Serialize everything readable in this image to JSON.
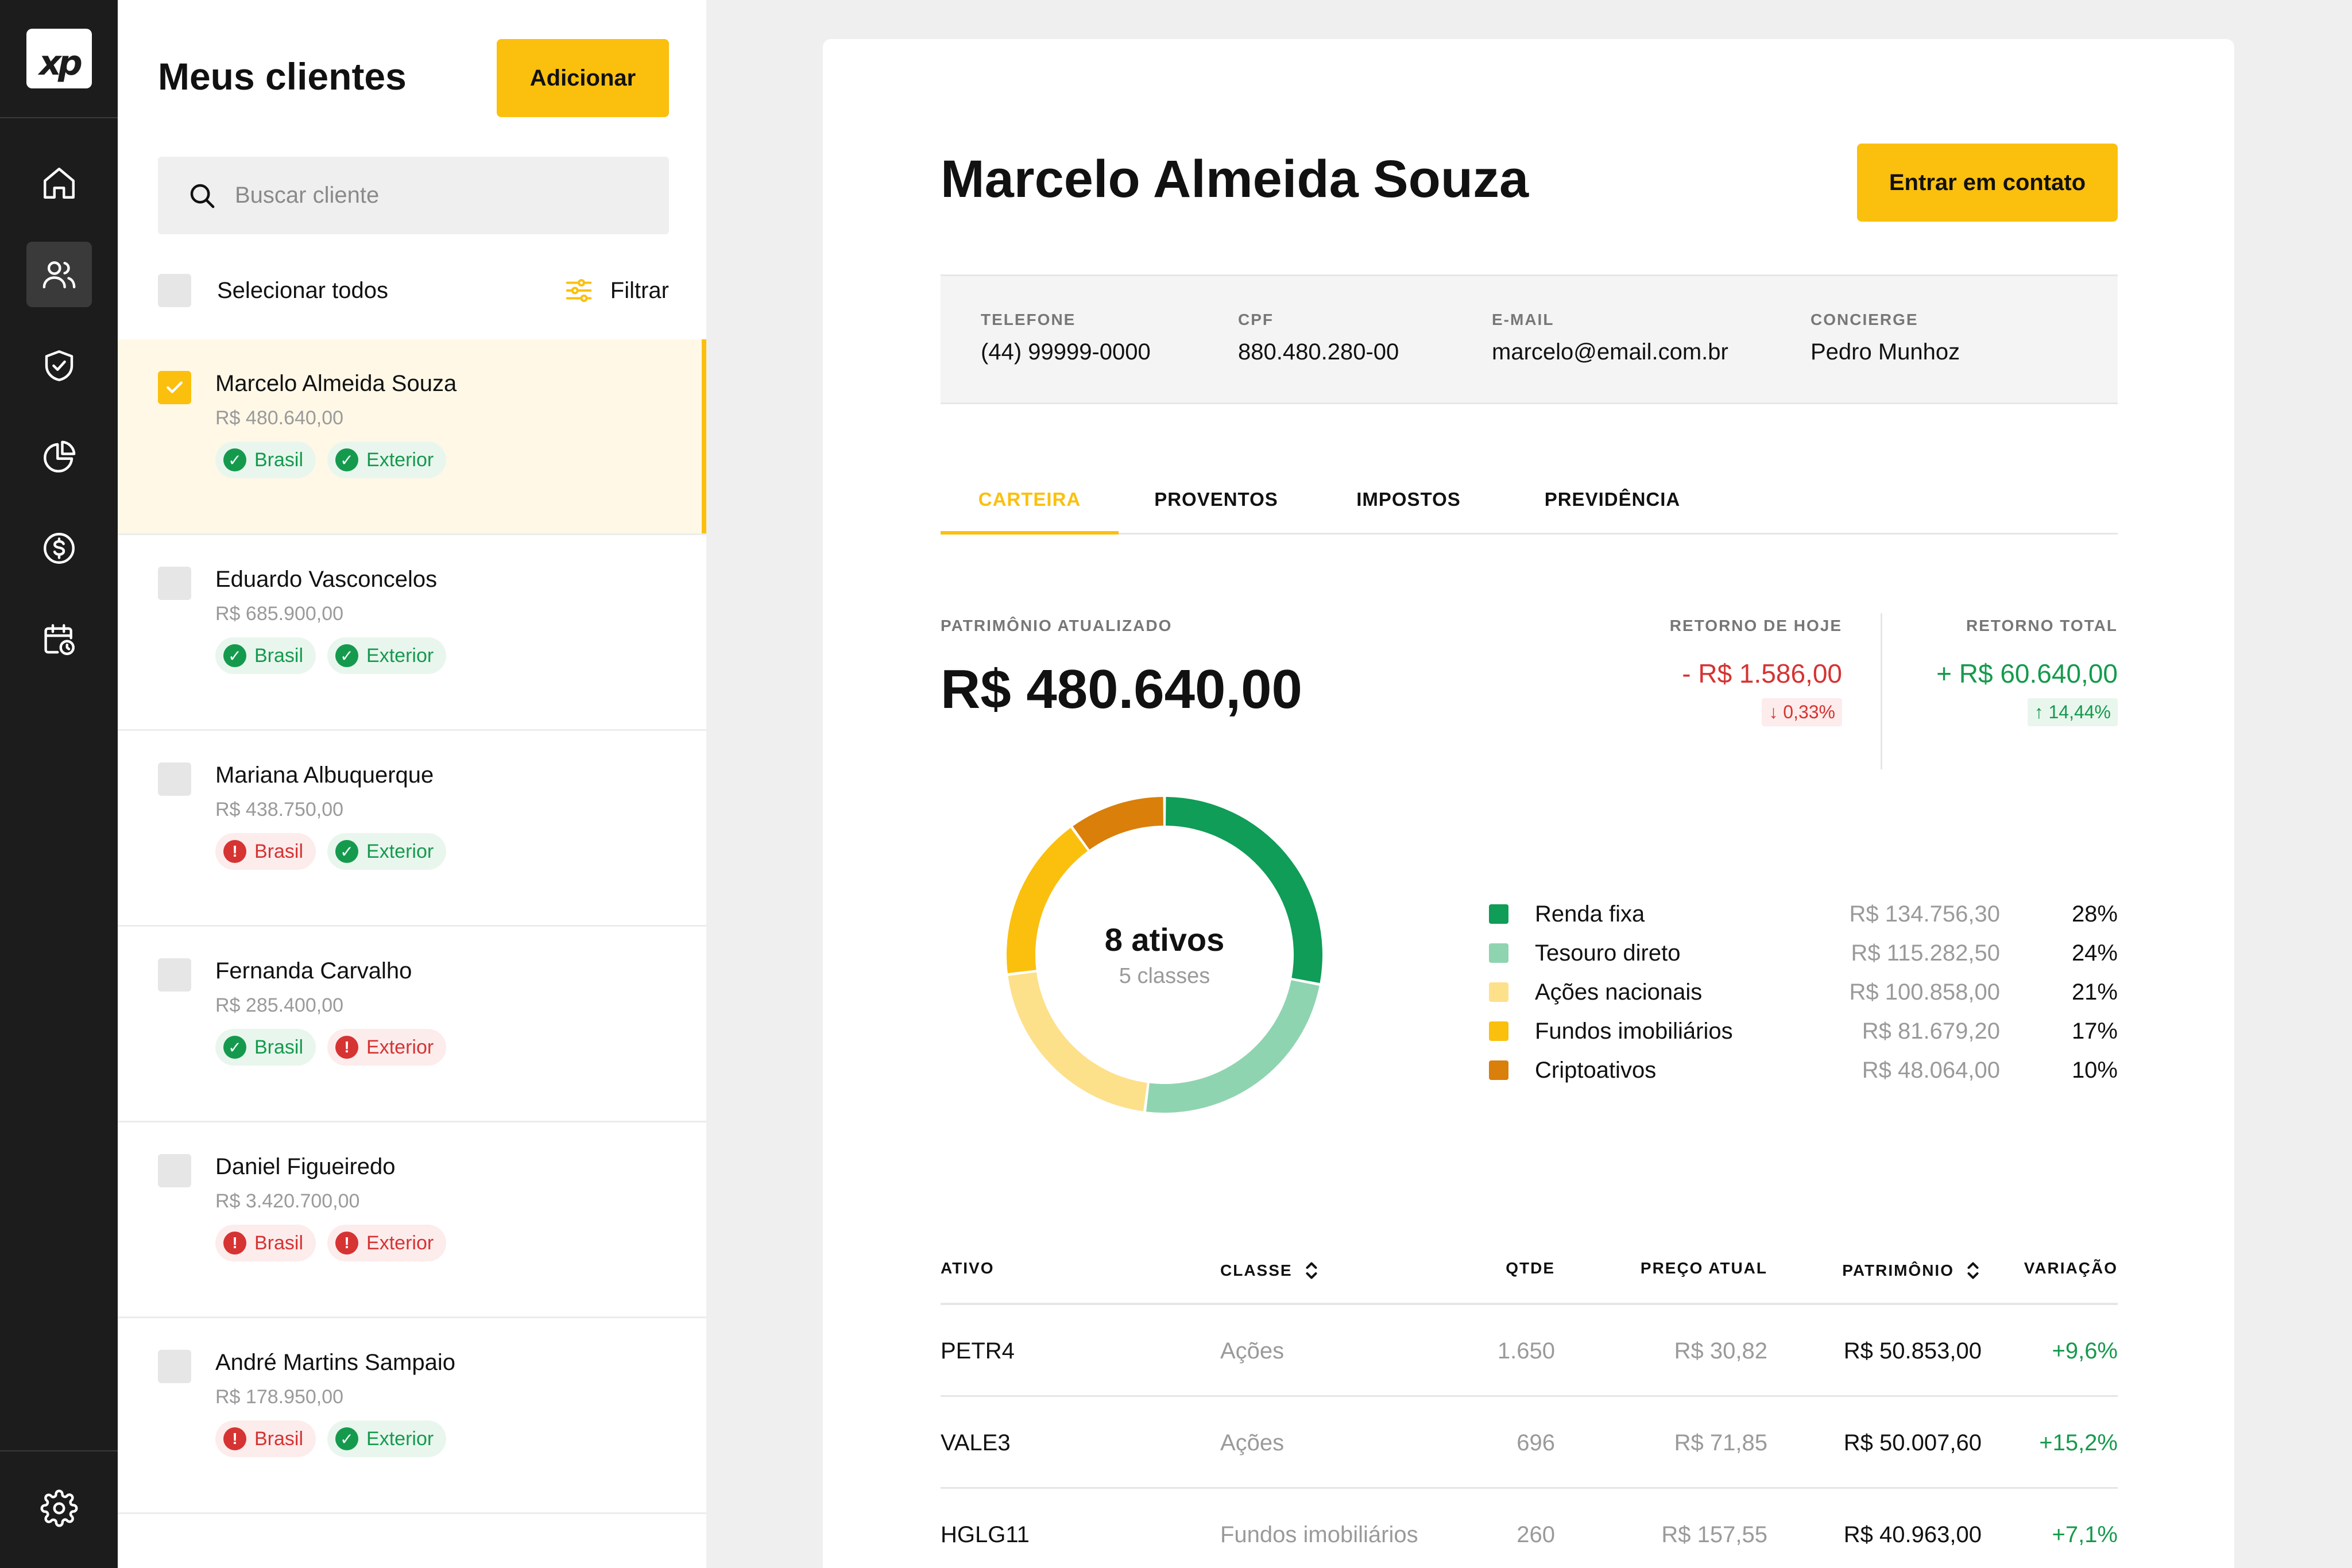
{
  "brand": {
    "logo": "xp",
    "accent": "#fbc00e"
  },
  "rail": {
    "items": [
      {
        "icon": "home-icon",
        "active": false
      },
      {
        "icon": "users-icon",
        "active": true
      },
      {
        "icon": "shield-check-icon",
        "active": false
      },
      {
        "icon": "pie-chart-icon",
        "active": false
      },
      {
        "icon": "dollar-icon",
        "active": false
      },
      {
        "icon": "calendar-clock-icon",
        "active": false
      }
    ],
    "bottom_icon": "gear-icon"
  },
  "clients": {
    "title": "Meus clientes",
    "add_label": "Adicionar",
    "search_placeholder": "Buscar cliente",
    "select_all": "Selecionar todos",
    "filter": "Filtrar",
    "list": [
      {
        "name": "Marcelo Almeida Souza",
        "amount": "R$ 480.640,00",
        "checked": true,
        "tags": [
          {
            "label": "Brasil",
            "status": "ok"
          },
          {
            "label": "Exterior",
            "status": "ok"
          }
        ]
      },
      {
        "name": "Eduardo Vasconcelos",
        "amount": "R$ 685.900,00",
        "checked": false,
        "tags": [
          {
            "label": "Brasil",
            "status": "ok"
          },
          {
            "label": "Exterior",
            "status": "ok"
          }
        ]
      },
      {
        "name": "Mariana Albuquerque",
        "amount": "R$ 438.750,00",
        "checked": false,
        "tags": [
          {
            "label": "Brasil",
            "status": "err"
          },
          {
            "label": "Exterior",
            "status": "ok"
          }
        ]
      },
      {
        "name": "Fernanda Carvalho",
        "amount": "R$ 285.400,00",
        "checked": false,
        "tags": [
          {
            "label": "Brasil",
            "status": "ok"
          },
          {
            "label": "Exterior",
            "status": "err"
          }
        ]
      },
      {
        "name": "Daniel Figueiredo",
        "amount": "R$ 3.420.700,00",
        "checked": false,
        "tags": [
          {
            "label": "Brasil",
            "status": "err"
          },
          {
            "label": "Exterior",
            "status": "err"
          }
        ]
      },
      {
        "name": "André Martins Sampaio",
        "amount": "R$ 178.950,00",
        "checked": false,
        "tags": [
          {
            "label": "Brasil",
            "status": "err"
          },
          {
            "label": "Exterior",
            "status": "ok"
          }
        ]
      }
    ]
  },
  "detail": {
    "name": "Marcelo Almeida Souza",
    "contact_label": "Entrar em contato",
    "info": [
      {
        "key": "TELEFONE",
        "value": "(44) 99999-0000"
      },
      {
        "key": "CPF",
        "value": "880.480.280-00"
      },
      {
        "key": "E-MAIL",
        "value": "marcelo@email.com.br"
      },
      {
        "key": "CONCIERGE",
        "value": "Pedro Munhoz"
      }
    ],
    "tabs": [
      "CARTEIRA",
      "PROVENTOS",
      "IMPOSTOS",
      "PREVIDÊNCIA"
    ],
    "active_tab": 0,
    "patrimonio_label": "PATRIMÔNIO ATUALIZADO",
    "patrimonio_value": "R$ 480.640,00",
    "retorno_hoje": {
      "label": "RETORNO DE HOJE",
      "value": "- R$ 1.586,00",
      "pct": "↓ 0,33%"
    },
    "retorno_total": {
      "label": "RETORNO TOTAL",
      "value": "+ R$ 60.640,00",
      "pct": "↑ 14,44%"
    },
    "donut_center": {
      "main": "8 ativos",
      "sub": "5 classes"
    },
    "allocation": [
      {
        "name": "Renda fixa",
        "value": "R$ 134.756,30",
        "pct": "28%",
        "share": 28,
        "color": "#0f9d58"
      },
      {
        "name": "Tesouro direto",
        "value": "R$ 115.282,50",
        "pct": "24%",
        "share": 24,
        "color": "#8fd4b0"
      },
      {
        "name": "Ações nacionais",
        "value": "R$ 100.858,00",
        "pct": "21%",
        "share": 21,
        "color": "#fde08a"
      },
      {
        "name": "Fundos imobiliários",
        "value": "R$ 81.679,20",
        "pct": "17%",
        "share": 17,
        "color": "#fbc00e"
      },
      {
        "name": "Criptoativos",
        "value": "R$ 48.064,00",
        "pct": "10%",
        "share": 10,
        "color": "#d97f0a"
      }
    ],
    "table": {
      "headers": {
        "ativo": "ATIVO",
        "classe": "CLASSE",
        "qtde": "QTDE",
        "preco": "PREÇO ATUAL",
        "patrimonio": "PATRIMÔNIO",
        "variacao": "VARIAÇÃO"
      },
      "rows": [
        {
          "ativo": "PETR4",
          "classe": "Ações",
          "qtde": "1.650",
          "preco": "R$ 30,82",
          "patrimonio": "R$ 50.853,00",
          "variacao": "+9,6%"
        },
        {
          "ativo": "VALE3",
          "classe": "Ações",
          "qtde": "696",
          "preco": "R$ 71,85",
          "patrimonio": "R$ 50.007,60",
          "variacao": "+15,2%"
        },
        {
          "ativo": "HGLG11",
          "classe": "Fundos imobiliários",
          "qtde": "260",
          "preco": "R$ 157,55",
          "patrimonio": "R$ 40.963,00",
          "variacao": "+7,1%"
        }
      ]
    }
  }
}
